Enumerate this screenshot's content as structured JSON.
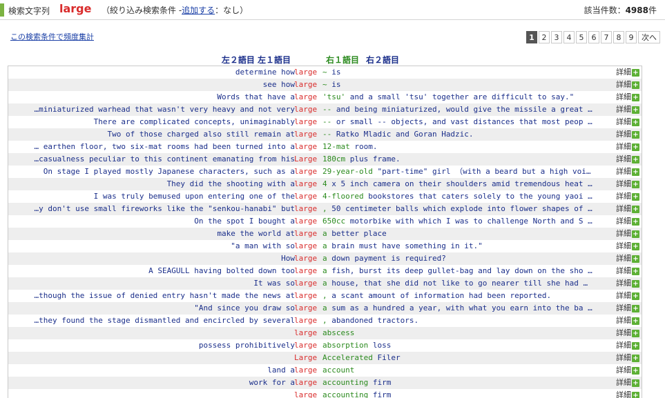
{
  "header": {
    "search_label": "検索文字列",
    "query": "large",
    "filter_prefix": "（絞り込み検索条件 -",
    "filter_link": "追加する",
    "filter_suffix": "：なし）",
    "count_label": "該当件数：",
    "count_value": "4988",
    "count_unit": "件"
  },
  "freq_link": "この検索条件で頻度集計",
  "pagination": {
    "pages": [
      "1",
      "2",
      "3",
      "4",
      "5",
      "6",
      "7",
      "8",
      "9"
    ],
    "active": "1",
    "next_label": "次へ"
  },
  "columns": {
    "left": "左２語目 左１語目",
    "right_1": "右１語目",
    "right_2": "右２語目"
  },
  "detail_label": "詳細",
  "rows": [
    {
      "left": "determine how",
      "kw": "large",
      "r1": "~",
      "rest": " is"
    },
    {
      "left": "see how",
      "kw": "large",
      "r1": "~",
      "rest": " is"
    },
    {
      "left": "Words that have a",
      "kw": "large",
      "r1": "'tsu'",
      "rest": " and a small 'tsu' together are difficult to say.\""
    },
    {
      "left": "…miniaturized warhead that wasn't very heavy and not very",
      "kw": "large",
      "r1": "--",
      "rest": " and being miniaturized, would give the missile a great …"
    },
    {
      "left": "There are complicated concepts, unimaginably",
      "kw": "large",
      "r1": "--",
      "rest": " or small -- objects, and vast distances that most peop …"
    },
    {
      "left": "Two of those charged also still remain at",
      "kw": "large",
      "r1": "--",
      "rest": " Ratko Mladic and Goran Hadzic."
    },
    {
      "left": "… earthen floor, two six-mat rooms had been turned into a",
      "kw": "large",
      "r1": "12-mat",
      "rest": " room."
    },
    {
      "left": "…casualness peculiar to this continent emanating from his",
      "kw": "Large",
      "r1": "180cm",
      "rest": " plus frame."
    },
    {
      "left": "On stage I played mostly Japanese characters, such as a",
      "kw": "large",
      "r1": "29-year-old",
      "rest": " \"part-time\" girl （with a beard but a high voi…"
    },
    {
      "left": "They did the shooting with a",
      "kw": "large",
      "r1": "4",
      "rest": " x 5 inch camera on their shoulders amid tremendous heat …"
    },
    {
      "left": "I was truly bemused upon entering one of the",
      "kw": "large",
      "r1": "4-floored",
      "rest": " bookstores that caters solely to the young yaoi …"
    },
    {
      "left": "…y don't use small fireworks like the \"senkou-hanabi\" but",
      "kw": "large",
      "r1": ",",
      "rest": " 50 centimeter balls which explode into flower shapes of …"
    },
    {
      "left": "On the spot I bought a",
      "kw": "large",
      "r1": "650cc",
      "rest": " motorbike with which I was to challenge North and S …"
    },
    {
      "left": "make the world at",
      "kw": "large",
      "r1": "a",
      "rest": " better place"
    },
    {
      "left": "\"a man with so",
      "kw": "large",
      "r1": "a",
      "rest": " brain must have something in it.\""
    },
    {
      "left": "How",
      "kw": "large",
      "r1": "a",
      "rest": " down payment is required?"
    },
    {
      "left": "A SEAGULL having bolted down too",
      "kw": "large",
      "r1": "a",
      "rest": " fish, burst its deep gullet-bag and lay down on the sho …"
    },
    {
      "left": "It was so",
      "kw": "large",
      "r1": "a",
      "rest": " house, that she did not like to go nearer till she had …"
    },
    {
      "left": "…though the issue of denied entry hasn't made the news at",
      "kw": "large",
      "r1": ",",
      "rest": " a scant amount of information had been reported."
    },
    {
      "left": "\"And since you draw so",
      "kw": "large",
      "r1": "a",
      "rest": " sum as a hundred a year, with what you earn into the ba …"
    },
    {
      "left": "…they found the stage dismantled and encircled by several",
      "kw": "large",
      "r1": ",",
      "rest": " abandoned tractors."
    },
    {
      "left": "",
      "kw": "large",
      "r1": "abscess",
      "rest": ""
    },
    {
      "left": "possess prohibitively",
      "kw": "large",
      "r1": "absorption",
      "rest": " loss"
    },
    {
      "left": "",
      "kw": "Large",
      "r1": "Accelerated",
      "rest": " Filer"
    },
    {
      "left": "land a",
      "kw": "large",
      "r1": "account",
      "rest": ""
    },
    {
      "left": "work for a",
      "kw": "large",
      "r1": "accounting",
      "rest": " firm"
    },
    {
      "left": "",
      "kw": "large",
      "r1": "accounting",
      "rest": " firm"
    }
  ]
}
